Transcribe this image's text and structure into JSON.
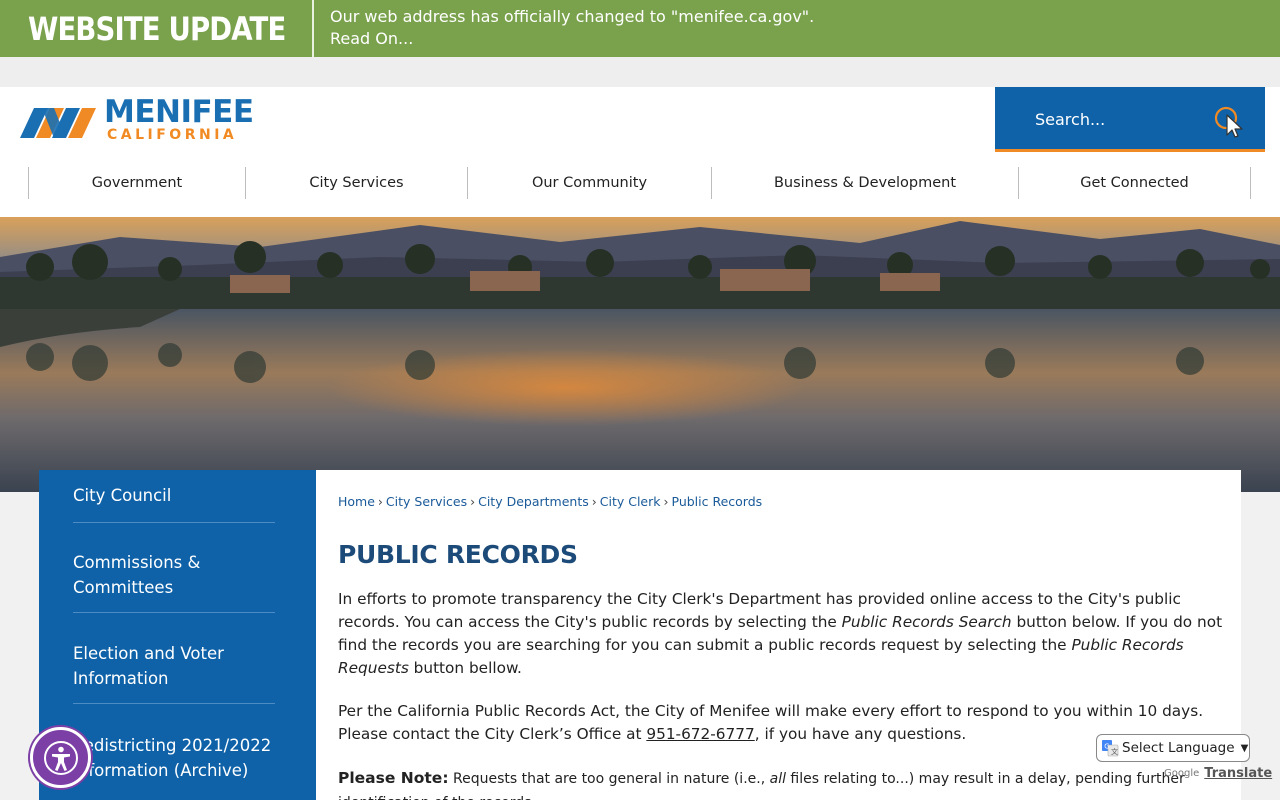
{
  "alert": {
    "title": "WEBSITE UPDATE",
    "message": "Our web address has officially changed to \"menifee.ca.gov\".",
    "link": "Read On..."
  },
  "logo": {
    "main": "MENIFEE",
    "sub": "CALIFORNIA"
  },
  "search": {
    "placeholder": "Search..."
  },
  "nav": [
    "Government",
    "City Services",
    "Our Community",
    "Business & Development",
    "Get Connected"
  ],
  "sidebar": {
    "items": [
      "City Council",
      "Commissions & Committees",
      "Election and Voter Information",
      "Redistricting 2021/2022 Information (Archive)"
    ]
  },
  "breadcrumb": {
    "items": [
      "Home",
      "City Services",
      "City Departments",
      "City Clerk",
      "Public Records"
    ],
    "separator": "›"
  },
  "page": {
    "title": "PUBLIC RECORDS",
    "p1_a": "In efforts to promote transparency the City Clerk's Department has provided online access to the City's public records. You can access the City's public records by selecting the ",
    "p1_b": "Public Records Search",
    "p1_c": " button below. If you do not find the records you are searching for you can submit a public records request by selecting the ",
    "p1_d": "Public Records Requests",
    "p1_e": " button bellow.",
    "p2_a": "Per the California Public Records Act, the City of Menifee will make every effort to respond to you within 10 days. Please contact the City Clerk’s Office at ",
    "p2_phone": "951-672-6777",
    "p2_b": ", if you have any questions.",
    "note_label": "Please Note:",
    "note_a": " Requests that are too general in nature (i.e., ",
    "note_b": "all",
    "note_c": " files relating to...) may result in a delay, pending further identification of the records."
  },
  "translate": {
    "select_label": "Select Language",
    "powered_by": "Google",
    "translate_label": "Translate"
  },
  "icons": {
    "alert": "megaphone-icon",
    "search": "search-cursor-icon",
    "accessibility": "accessibility-icon",
    "translate": "google-translate-icon"
  },
  "colors": {
    "alert_bg": "#7aa24d",
    "brand_blue": "#0f62a8",
    "brand_orange": "#f08a24",
    "title_blue": "#1c4b7a"
  }
}
